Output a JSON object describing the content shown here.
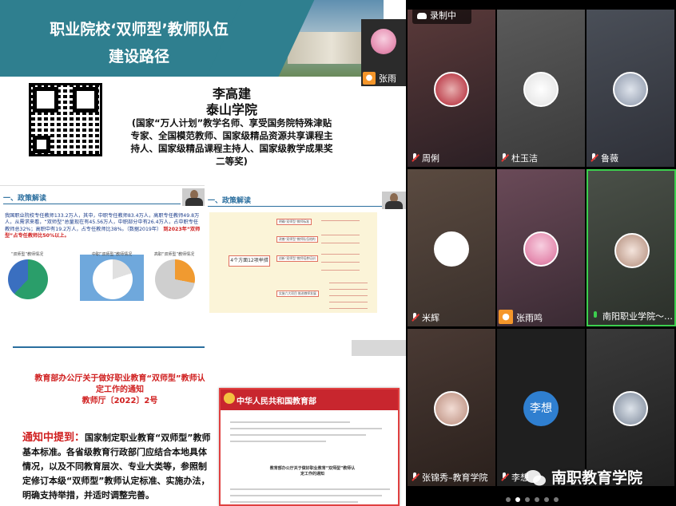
{
  "slide1": {
    "title_line1": "职业院校‘双师型’教师队伍",
    "title_line2": "建设路径",
    "speaker_name": "李高建",
    "speaker_org": "泰山学院",
    "speaker_desc": "(国家“万人计划”教学名师、享受国务院特殊津贴专家、全国模范教师、国家级精品资源共享课程主持人、国家级精品课程主持人、国家级教学成果奖二等奖)"
  },
  "slide2": {
    "heading": "一、政策解读",
    "para": "我国职业院校专任教师133.2万人，其中，中职专任教师83.4万人，高职专任教师49.8万人，从需求来看，“双师型”总量现在有45.56万人，中职部分中有26.4万人，占中职专任教师总32%；高职中有19.2万人，占专任教师比38%。（数据2019年）",
    "para_red": "到2023年“双师型”占专任教师比50%以上。",
    "pie_labels": [
      "“双师型”教师情况",
      "中职“双师型”教师情况",
      "高职“双师型”教师情况"
    ]
  },
  "slide3": {
    "heading": "一、政策解读",
    "root": "4个方面12项举措",
    "nodes": [
      "明确“双师型”教师标准",
      "改善“双师型”教师队伍结构",
      "创新“双师型”教师培养培训",
      "实施六大项目 推进教师发展"
    ]
  },
  "slide4": {
    "notice_title": "教育部办公厅关于做好职业教育“双师型”教师认定工作的通知",
    "notice_num": "教师厅〔2022〕2号",
    "body_label": "通知中提到：",
    "body_text": "国家制定职业教育“双师型”教师基本标准。各省级教育行政部门应结合本地具体情况，以及不同教育层次、专业大类等，参照制定修订本级“双师型”教师认定标准、实施办法，明确支持举措，并适时调整完善。",
    "doc_header": "中华人民共和国教育部",
    "doc_title": "教育部办公厅关于做好职业教育“双师型”教师认定工作的通知"
  },
  "thumb_name": "张雨",
  "recording_label": "录制中",
  "participants": [
    {
      "name": "周俐",
      "mic": "muted"
    },
    {
      "name": "杜玉洁",
      "mic": "muted"
    },
    {
      "name": "鲁薇",
      "mic": "muted"
    },
    {
      "name": "米辉",
      "mic": "muted"
    },
    {
      "name": "张雨鸣",
      "mic": "muted"
    },
    {
      "name": "南阳职业学院～…",
      "mic": "on"
    },
    {
      "name": "张锦秀–教育学院",
      "mic": "muted"
    },
    {
      "name": "李想",
      "mic": "muted",
      "avatar_text": "李想",
      "label": "李想"
    },
    {
      "name": "",
      "mic": "none"
    }
  ],
  "watermark": "南职教育学院",
  "colors": {
    "accent": "#2f7f8f",
    "active_border": "#3ccf4e",
    "red": "#d02020"
  }
}
